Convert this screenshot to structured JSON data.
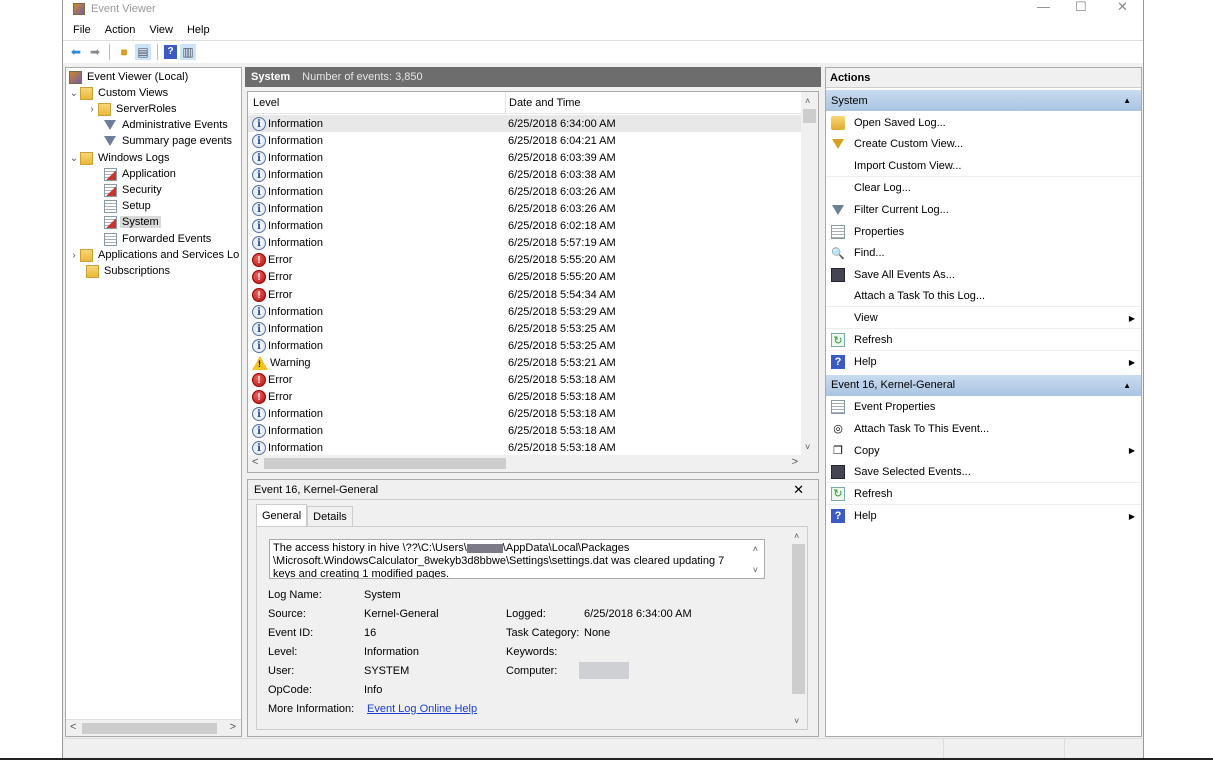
{
  "window": {
    "title": "Event Viewer",
    "controls": {
      "minimize": "—",
      "maximize": "☐",
      "close": "✕"
    }
  },
  "menu": [
    "File",
    "Action",
    "View",
    "Help"
  ],
  "toolbar": {
    "buttons": [
      "back-arrow",
      "forward-arrow",
      "folder-up",
      "show-hide-console-tree",
      "help",
      "show-hide-action-pane"
    ]
  },
  "tree": {
    "nodes": [
      {
        "label": "Event Viewer (Local)",
        "icon": "event-viewer-icon",
        "level": 0,
        "expander": ""
      },
      {
        "label": "Custom Views",
        "icon": "folder-icon",
        "level": 0,
        "expander": "expanded"
      },
      {
        "label": "ServerRoles",
        "icon": "folder-icon",
        "level": 1,
        "expander": "collapsed"
      },
      {
        "label": "Administrative Events",
        "icon": "filter-icon",
        "level": 1,
        "expander": ""
      },
      {
        "label": "Summary page events",
        "icon": "filter-icon",
        "level": 1,
        "expander": ""
      },
      {
        "label": "Windows Logs",
        "icon": "folder-icon",
        "level": 0,
        "expander": "expanded"
      },
      {
        "label": "Application",
        "icon": "log-icon",
        "level": 1,
        "expander": ""
      },
      {
        "label": "Security",
        "icon": "log-icon",
        "level": 1,
        "expander": ""
      },
      {
        "label": "Setup",
        "icon": "log-plain-icon",
        "level": 1,
        "expander": ""
      },
      {
        "label": "System",
        "icon": "log-icon",
        "level": 1,
        "expander": "",
        "selected": true
      },
      {
        "label": "Forwarded Events",
        "icon": "log-plain-icon",
        "level": 1,
        "expander": ""
      },
      {
        "label": "Applications and Services Lo",
        "icon": "folder-icon",
        "level": 0,
        "expander": "collapsed"
      },
      {
        "label": "Subscriptions",
        "icon": "folder-icon",
        "level": 0,
        "expander": ""
      }
    ]
  },
  "log": {
    "name": "System",
    "count_label": "Number of events: 3,850",
    "columns": [
      "Level",
      "Date and Time"
    ],
    "rows": [
      {
        "level": "Information",
        "type": "info",
        "datetime": "6/25/2018 6:34:00 AM",
        "selected": true
      },
      {
        "level": "Information",
        "type": "info",
        "datetime": "6/25/2018 6:04:21 AM"
      },
      {
        "level": "Information",
        "type": "info",
        "datetime": "6/25/2018 6:03:39 AM"
      },
      {
        "level": "Information",
        "type": "info",
        "datetime": "6/25/2018 6:03:38 AM"
      },
      {
        "level": "Information",
        "type": "info",
        "datetime": "6/25/2018 6:03:26 AM"
      },
      {
        "level": "Information",
        "type": "info",
        "datetime": "6/25/2018 6:03:26 AM"
      },
      {
        "level": "Information",
        "type": "info",
        "datetime": "6/25/2018 6:02:18 AM"
      },
      {
        "level": "Information",
        "type": "info",
        "datetime": "6/25/2018 5:57:19 AM"
      },
      {
        "level": "Error",
        "type": "error",
        "datetime": "6/25/2018 5:55:20 AM"
      },
      {
        "level": "Error",
        "type": "error",
        "datetime": "6/25/2018 5:55:20 AM"
      },
      {
        "level": "Error",
        "type": "error",
        "datetime": "6/25/2018 5:54:34 AM"
      },
      {
        "level": "Information",
        "type": "info",
        "datetime": "6/25/2018 5:53:29 AM"
      },
      {
        "level": "Information",
        "type": "info",
        "datetime": "6/25/2018 5:53:25 AM"
      },
      {
        "level": "Information",
        "type": "info",
        "datetime": "6/25/2018 5:53:25 AM"
      },
      {
        "level": "Warning",
        "type": "warning",
        "datetime": "6/25/2018 5:53:21 AM"
      },
      {
        "level": "Error",
        "type": "error",
        "datetime": "6/25/2018 5:53:18 AM"
      },
      {
        "level": "Error",
        "type": "error",
        "datetime": "6/25/2018 5:53:18 AM"
      },
      {
        "level": "Information",
        "type": "info",
        "datetime": "6/25/2018 5:53:18 AM"
      },
      {
        "level": "Information",
        "type": "info",
        "datetime": "6/25/2018 5:53:18 AM"
      },
      {
        "level": "Information",
        "type": "info",
        "datetime": "6/25/2018 5:53:18 AM"
      }
    ]
  },
  "detail": {
    "title": "Event 16, Kernel-General",
    "close": "✕",
    "tabs": [
      "General",
      "Details"
    ],
    "active_tab": "General",
    "description_part1": "The access history in hive \\??\\C:\\Users\\",
    "description_part2": "\\AppData\\Local\\Packages \\Microsoft.WindowsCalculator_8wekyb3d8bbwe\\Settings\\settings.dat was cleared updating 7 keys and creating 1 modified pages.",
    "fields": {
      "log_name": {
        "label": "Log Name:",
        "value": "System"
      },
      "source": {
        "label": "Source:",
        "value": "Kernel-General"
      },
      "event_id": {
        "label": "Event ID:",
        "value": "16"
      },
      "level": {
        "label": "Level:",
        "value": "Information"
      },
      "user": {
        "label": "User:",
        "value": "SYSTEM"
      },
      "opcode": {
        "label": "OpCode:",
        "value": "Info"
      },
      "more_info": {
        "label": "More Information:",
        "value": "Event Log Online Help"
      },
      "logged": {
        "label": "Logged:",
        "value": "6/25/2018 6:34:00 AM"
      },
      "task_category": {
        "label": "Task Category:",
        "value": "None"
      },
      "keywords": {
        "label": "Keywords:",
        "value": ""
      },
      "computer": {
        "label": "Computer:",
        "value": ""
      }
    }
  },
  "actions": {
    "title": "Actions",
    "sections": [
      {
        "title": "System",
        "items": [
          {
            "label": "Open Saved Log...",
            "icon": "open-folder",
            "submenu": false
          },
          {
            "label": "Create Custom View...",
            "icon": "filter-yellow",
            "submenu": false
          },
          {
            "label": "Import Custom View...",
            "icon": "",
            "submenu": false,
            "sep": true
          },
          {
            "label": "Clear Log...",
            "icon": "",
            "submenu": false
          },
          {
            "label": "Filter Current Log...",
            "icon": "filter",
            "submenu": false
          },
          {
            "label": "Properties",
            "icon": "properties",
            "submenu": false
          },
          {
            "label": "Find...",
            "icon": "find",
            "submenu": false
          },
          {
            "label": "Save All Events As...",
            "icon": "save",
            "submenu": false
          },
          {
            "label": "Attach a Task To this Log...",
            "icon": "",
            "submenu": false,
            "sep": true
          },
          {
            "label": "View",
            "icon": "",
            "submenu": true,
            "sep": true
          },
          {
            "label": "Refresh",
            "icon": "refresh",
            "submenu": false,
            "sep": true
          },
          {
            "label": "Help",
            "icon": "help",
            "submenu": true
          }
        ]
      },
      {
        "title": "Event 16, Kernel-General",
        "items": [
          {
            "label": "Event Properties",
            "icon": "properties",
            "submenu": false
          },
          {
            "label": "Attach Task To This Event...",
            "icon": "task",
            "submenu": false
          },
          {
            "label": "Copy",
            "icon": "copy",
            "submenu": true
          },
          {
            "label": "Save Selected Events...",
            "icon": "save",
            "submenu": false,
            "sep": true
          },
          {
            "label": "Refresh",
            "icon": "refresh",
            "submenu": false,
            "sep": true
          },
          {
            "label": "Help",
            "icon": "help",
            "submenu": true
          }
        ]
      }
    ]
  },
  "scroll": {
    "left": "<",
    "right": ">",
    "up": "^",
    "down": "v"
  }
}
